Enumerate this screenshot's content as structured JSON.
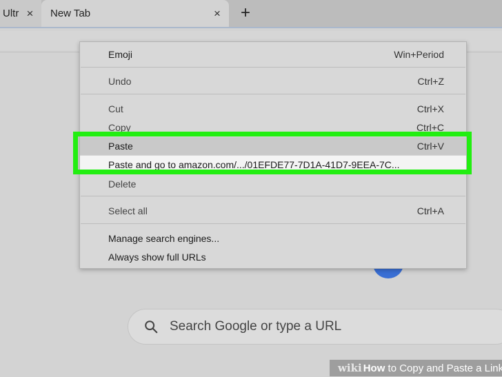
{
  "tabs": [
    {
      "title": "Ultr",
      "close_icon": "×"
    },
    {
      "title": "New Tab",
      "close_icon": "×"
    }
  ],
  "new_tab_icon": "+",
  "search": {
    "placeholder": "Search Google or type a URL"
  },
  "context_menu": {
    "items": [
      {
        "label": "Emoji",
        "shortcut": "Win+Period"
      },
      {
        "label": "Undo",
        "shortcut": "Ctrl+Z"
      },
      {
        "label": "Cut",
        "shortcut": "Ctrl+X"
      },
      {
        "label": "Copy",
        "shortcut": "Ctrl+C"
      },
      {
        "label": "Paste",
        "shortcut": "Ctrl+V"
      },
      {
        "label": "Paste and go to amazon.com/.../01EFDE77-7D1A-41D7-9EEA-7C...",
        "shortcut": ""
      },
      {
        "label": "Delete",
        "shortcut": ""
      },
      {
        "label": "Select all",
        "shortcut": "Ctrl+A"
      },
      {
        "label": "Manage search engines...",
        "shortcut": ""
      },
      {
        "label": "Always show full URLs",
        "shortcut": ""
      }
    ]
  },
  "highlight_color": "#22ee11",
  "watermark": {
    "wiki": "wiki",
    "how": "How",
    "rest": " to Copy and Paste a Link"
  }
}
